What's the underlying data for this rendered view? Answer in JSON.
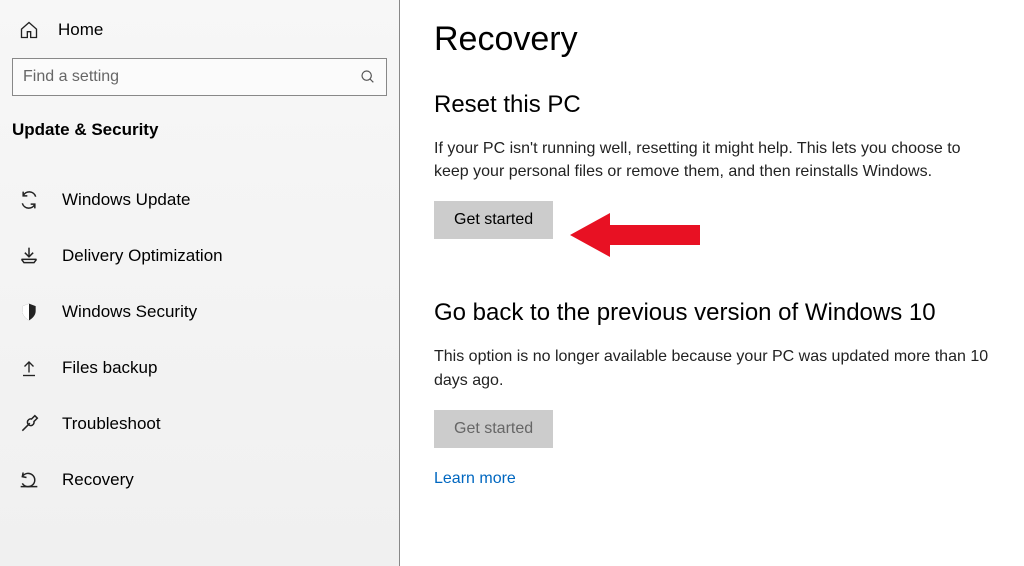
{
  "sidebar": {
    "home": "Home",
    "search_placeholder": "Find a setting",
    "category": "Update & Security",
    "items": [
      {
        "label": "Windows Update"
      },
      {
        "label": "Delivery Optimization"
      },
      {
        "label": "Windows Security"
      },
      {
        "label": "Files backup"
      },
      {
        "label": "Troubleshoot"
      },
      {
        "label": "Recovery"
      }
    ]
  },
  "main": {
    "title": "Recovery",
    "reset": {
      "heading": "Reset this PC",
      "desc": "If your PC isn't running well, resetting it might help. This lets you choose to keep your personal files or remove them, and then reinstalls Windows.",
      "button": "Get started"
    },
    "goback": {
      "heading": "Go back to the previous version of Windows 10",
      "desc": "This option is no longer available because your PC was updated more than 10 days ago.",
      "button": "Get started",
      "learn_more": "Learn more"
    }
  }
}
